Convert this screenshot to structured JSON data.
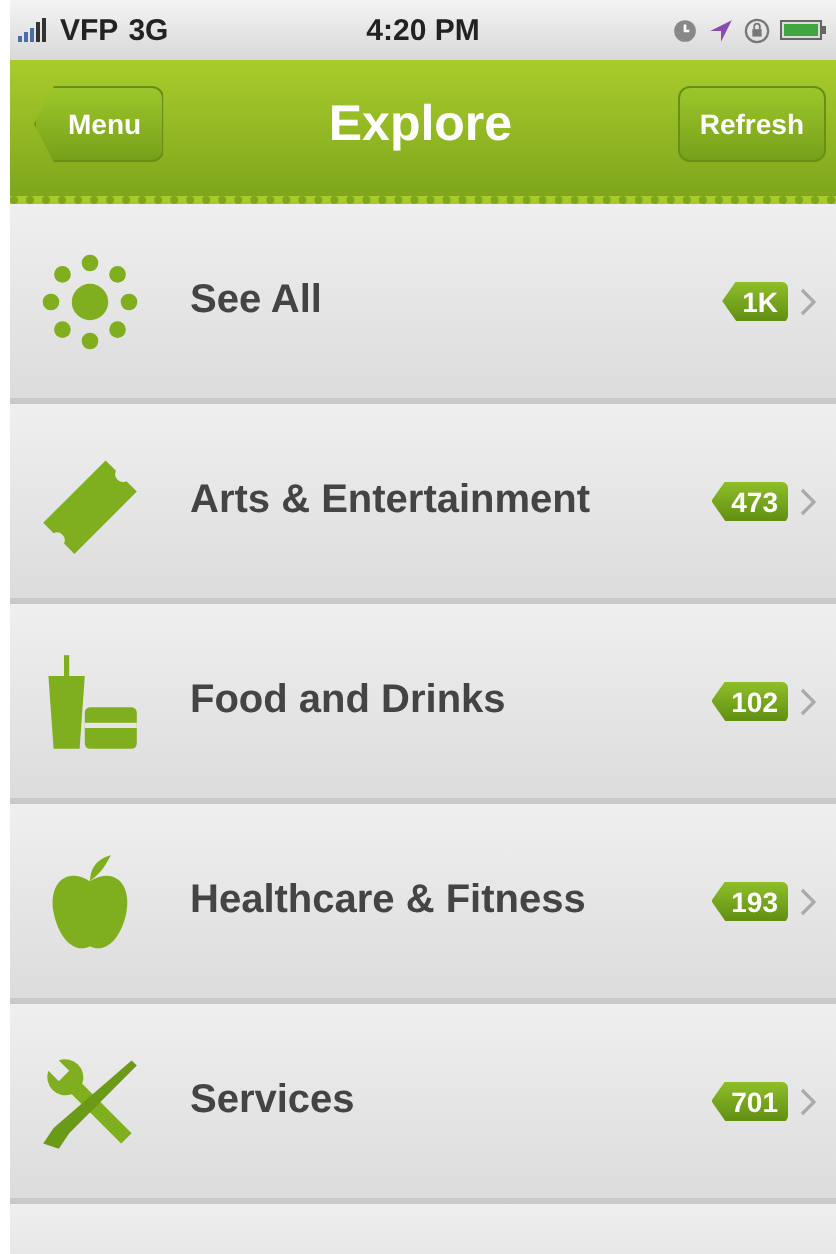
{
  "status_bar": {
    "carrier": "VFP",
    "network": "3G",
    "time": "4:20 PM"
  },
  "nav_bar": {
    "title": "Explore",
    "back_button": "Menu",
    "right_button": "Refresh"
  },
  "categories": [
    {
      "kind": "all",
      "label": "See All",
      "count": "1K"
    },
    {
      "kind": "ticket",
      "label": "Arts & Entertainment",
      "count": "473"
    },
    {
      "kind": "food",
      "label": "Food and Drinks",
      "count": "102"
    },
    {
      "kind": "apple",
      "label": "Healthcare & Fitness",
      "count": "193"
    },
    {
      "kind": "tools",
      "label": "Services",
      "count": "701"
    }
  ]
}
